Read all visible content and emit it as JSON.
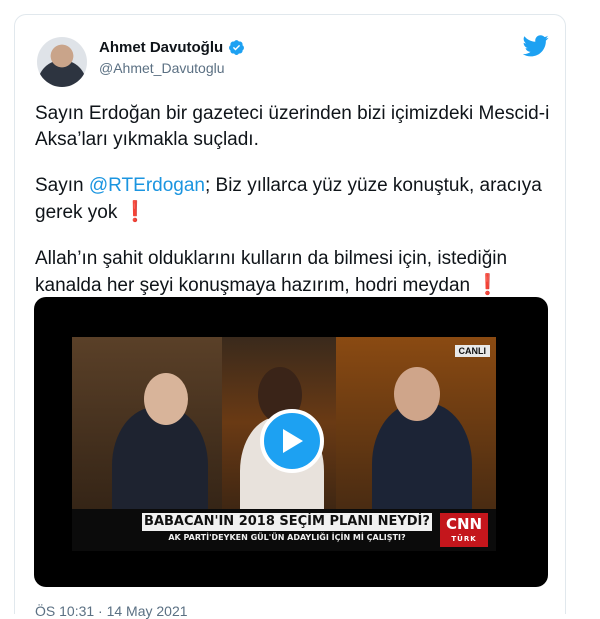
{
  "tweet": {
    "author_name": "Ahmet Davutoğlu",
    "handle": "@Ahmet_Davutoglu",
    "paragraph1": "Sayın Erdoğan bir gazeteci üzerinden bizi içimizdeki Mescid-i Aksa’ları yıkmakla suçladı.",
    "paragraph2_before": "Sayın ",
    "paragraph2_mention": "@RTErdogan",
    "paragraph2_after": "; Biz yıllarca yüz yüze konuştuk, aracıya gerek yok ",
    "paragraph3": "Allah’ın şahit olduklarını kulların da bilmesi için, istediğin kanalda her şeyi konuşmaya hazırım, hodri meydan ",
    "exclamation": "❗",
    "timestamp": "ÖS 10:31 · 14 May 2021"
  },
  "video": {
    "live_badge": "CANLI",
    "headline": "BABACAN'IN 2018 SEÇİM PLANI NEYDİ?",
    "subheadline": "AK PARTİ'DEYKEN GÜL'ÜN ADAYLIĞI İÇİN Mİ ÇALIŞTI?",
    "channel_logo": "CNN",
    "channel_sub": "TÜRK"
  },
  "icons": {
    "verified": "verified-badge-icon",
    "twitter": "twitter-bird-icon",
    "play": "play-icon"
  },
  "colors": {
    "twitter_blue": "#1da1f2",
    "mention": "#1b95e0",
    "exclamation": "#d41d2f",
    "cnn_red": "#c4161c"
  }
}
